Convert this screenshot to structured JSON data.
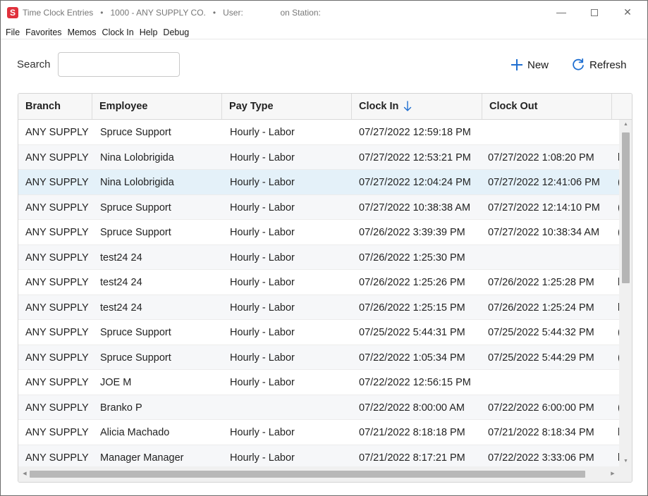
{
  "window": {
    "icon_letter": "S",
    "title": "Time Clock Entries",
    "separator": "•",
    "company": "1000 - ANY SUPPLY CO.",
    "user_label": "User:",
    "station_label": "on Station:"
  },
  "menu": [
    "File",
    "Favorites",
    "Memos",
    "Clock In",
    "Help",
    "Debug"
  ],
  "toolbar": {
    "search_label": "Search",
    "search_value": "",
    "new_label": "New",
    "refresh_label": "Refresh",
    "accent_color": "#1f6fd1"
  },
  "table": {
    "columns": [
      "Branch",
      "Employee",
      "Pay Type",
      "Clock In",
      "Clock Out"
    ],
    "sort_column": "Clock In",
    "sort_direction": "descending",
    "rows": [
      {
        "branch": "ANY SUPPLY",
        "employee": "Spruce Support",
        "pay_type": "Hourly - Labor",
        "clock_in": "07/27/2022 12:59:18 PM",
        "clock_out": "",
        "more": ""
      },
      {
        "branch": "ANY SUPPLY",
        "employee": "Nina Lolobrigida",
        "pay_type": "Hourly - Labor",
        "clock_in": "07/27/2022 12:53:21 PM",
        "clock_out": "07/27/2022 1:08:20 PM",
        "more": "l"
      },
      {
        "branch": "ANY SUPPLY",
        "employee": "Nina Lolobrigida",
        "pay_type": "Hourly - Labor",
        "clock_in": "07/27/2022 12:04:24 PM",
        "clock_out": "07/27/2022 12:41:06 PM",
        "more": "("
      },
      {
        "branch": "ANY SUPPLY",
        "employee": "Spruce Support",
        "pay_type": "Hourly - Labor",
        "clock_in": "07/27/2022 10:38:38 AM",
        "clock_out": "07/27/2022 12:14:10 PM",
        "more": "("
      },
      {
        "branch": "ANY SUPPLY",
        "employee": "Spruce Support",
        "pay_type": "Hourly - Labor",
        "clock_in": "07/26/2022 3:39:39 PM",
        "clock_out": "07/27/2022 10:38:34 AM",
        "more": "("
      },
      {
        "branch": "ANY SUPPLY",
        "employee": "test24 24",
        "pay_type": "Hourly - Labor",
        "clock_in": "07/26/2022 1:25:30 PM",
        "clock_out": "",
        "more": ""
      },
      {
        "branch": "ANY SUPPLY",
        "employee": "test24 24",
        "pay_type": "Hourly - Labor",
        "clock_in": "07/26/2022 1:25:26 PM",
        "clock_out": "07/26/2022 1:25:28 PM",
        "more": "l"
      },
      {
        "branch": "ANY SUPPLY",
        "employee": "test24 24",
        "pay_type": "Hourly - Labor",
        "clock_in": "07/26/2022 1:25:15 PM",
        "clock_out": "07/26/2022 1:25:24 PM",
        "more": "l"
      },
      {
        "branch": "ANY SUPPLY",
        "employee": "Spruce Support",
        "pay_type": "Hourly - Labor",
        "clock_in": "07/25/2022 5:44:31 PM",
        "clock_out": "07/25/2022 5:44:32 PM",
        "more": "("
      },
      {
        "branch": "ANY SUPPLY",
        "employee": "Spruce Support",
        "pay_type": "Hourly - Labor",
        "clock_in": "07/22/2022 1:05:34 PM",
        "clock_out": "07/25/2022 5:44:29 PM",
        "more": "("
      },
      {
        "branch": "ANY SUPPLY",
        "employee": "JOE M",
        "pay_type": "Hourly - Labor",
        "clock_in": "07/22/2022 12:56:15 PM",
        "clock_out": "",
        "more": ""
      },
      {
        "branch": "ANY SUPPLY",
        "employee": "Branko P",
        "pay_type": "",
        "clock_in": "07/22/2022 8:00:00 AM",
        "clock_out": "07/22/2022 6:00:00 PM",
        "more": "("
      },
      {
        "branch": "ANY SUPPLY",
        "employee": "Alicia Machado",
        "pay_type": "Hourly - Labor",
        "clock_in": "07/21/2022 8:18:18 PM",
        "clock_out": "07/21/2022 8:18:34 PM",
        "more": "l"
      },
      {
        "branch": "ANY SUPPLY",
        "employee": "Manager Manager",
        "pay_type": "Hourly - Labor",
        "clock_in": "07/21/2022 8:17:21 PM",
        "clock_out": "07/22/2022 3:33:06 PM",
        "more": "l"
      }
    ],
    "selected_row": 2
  }
}
